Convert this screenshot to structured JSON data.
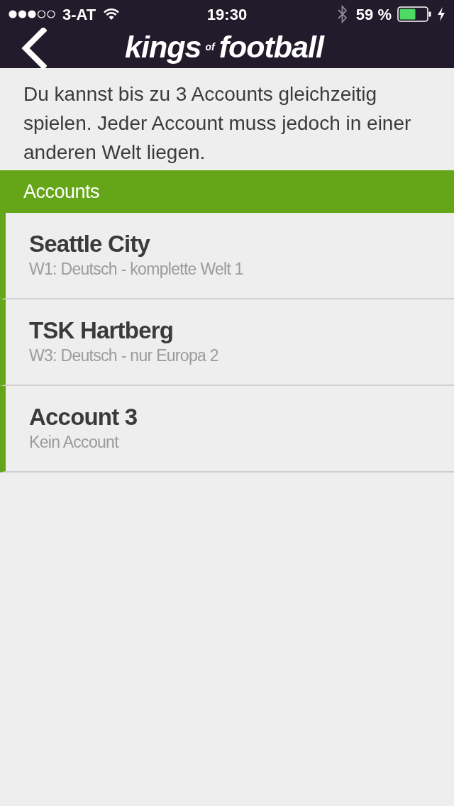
{
  "status_bar": {
    "carrier": "3-AT",
    "time": "19:30",
    "battery": "59 %"
  },
  "nav": {
    "logo": [
      {
        "text": "kings",
        "kind": "main"
      },
      {
        "text": "of",
        "kind": "small"
      },
      {
        "text": "football",
        "kind": "main"
      }
    ]
  },
  "intro": "Du kannst bis zu 3 Accounts gleichzeitig spielen. Jeder Account muss jedoch in einer anderen Welt liegen.",
  "section": {
    "title": "Accounts"
  },
  "accounts": [
    {
      "name": "Seattle City",
      "world": "W1: Deutsch - komplette Welt 1"
    },
    {
      "name": "TSK Hartberg",
      "world": "W3: Deutsch - nur Europa 2"
    },
    {
      "name": "Account 3",
      "world": "Kein Account"
    }
  ]
}
